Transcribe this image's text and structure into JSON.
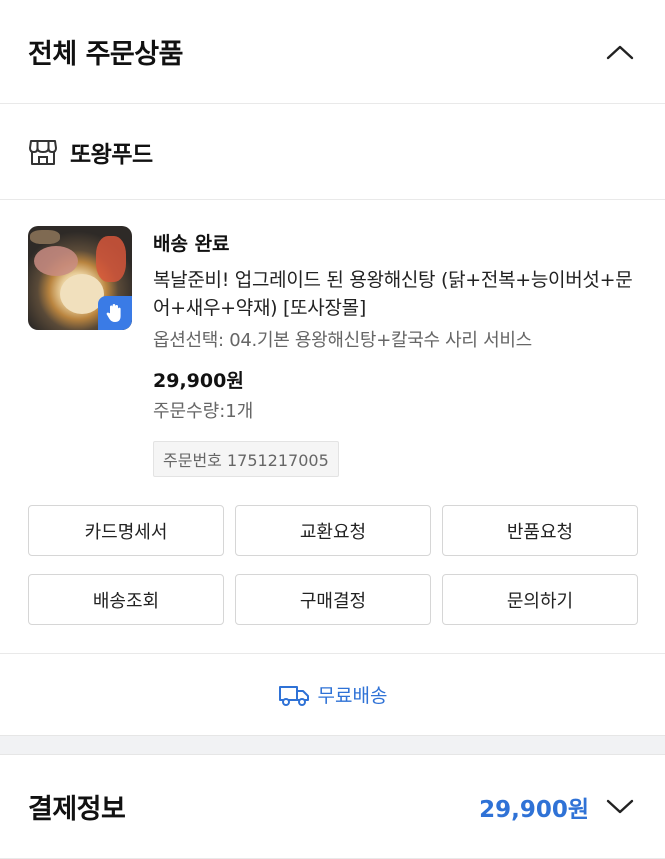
{
  "order_section": {
    "title": "전체 주문상품",
    "collapse_icon": "chevron-up-icon"
  },
  "store": {
    "icon": "store-icon",
    "name": "또왕푸드"
  },
  "item": {
    "status": "배송 완료",
    "name": "복날준비! 업그레이드 된 용왕해신탕 (닭+전복+능이버섯+문어+새우+약재) [또사장몰]",
    "option": "옵션선택: 04.기본 용왕해신탕+칼국수 사리 서비스",
    "price": "29,900원",
    "quantity": "주문수량:1개",
    "order_number": "주문번호 1751217005",
    "badge_icon": "hand-wave-icon"
  },
  "actions": [
    {
      "label": "카드명세서"
    },
    {
      "label": "교환요청"
    },
    {
      "label": "반품요청"
    },
    {
      "label": "배송조회"
    },
    {
      "label": "구매결정"
    },
    {
      "label": "문의하기"
    }
  ],
  "shipping": {
    "icon": "truck-icon",
    "label": "무료배송"
  },
  "payment": {
    "title": "결제정보",
    "total": "29,900원",
    "expand_icon": "chevron-down-icon"
  },
  "colors": {
    "accent": "#2f72d6",
    "badge": "#3a7be6"
  }
}
